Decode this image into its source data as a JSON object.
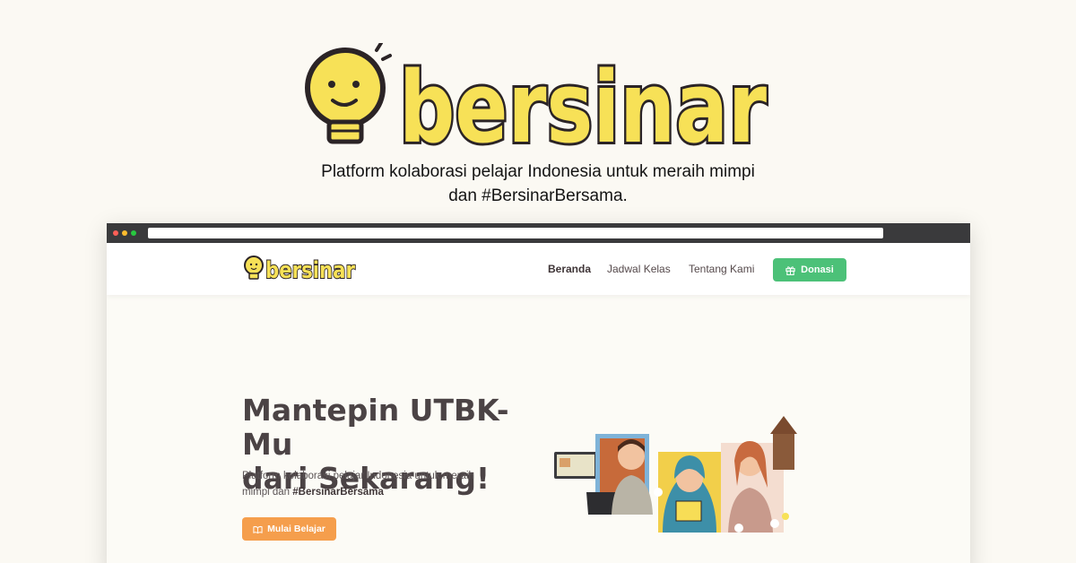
{
  "brand": {
    "name": "bersinar",
    "color_primary": "#f7e157",
    "color_outline": "#2b2426"
  },
  "tagline": {
    "line1": "Platform kolaborasi pelajar Indonesia untuk meraih mimpi",
    "line2": "dan #BersinarBersama."
  },
  "nav": {
    "links": [
      "Beranda",
      "Jadwal Kelas",
      "Tentang Kami"
    ],
    "active": "Beranda",
    "donate_label": "Donasi",
    "donate_icon": "gift-icon",
    "donate_color": "#4cc178"
  },
  "hero": {
    "title_line1": "Mantepin UTBK-Mu",
    "title_line2": "dari Sekarang!",
    "subtitle_line1": "Platform kolaborasi pelajar Indonesia untuk meraih",
    "subtitle_prefix": "mimpi dan ",
    "subtitle_hashtag": "#BersinarBersama",
    "cta_label": "Mulai Belajar",
    "cta_icon": "book-open-icon",
    "cta_color": "#f59e4c"
  }
}
